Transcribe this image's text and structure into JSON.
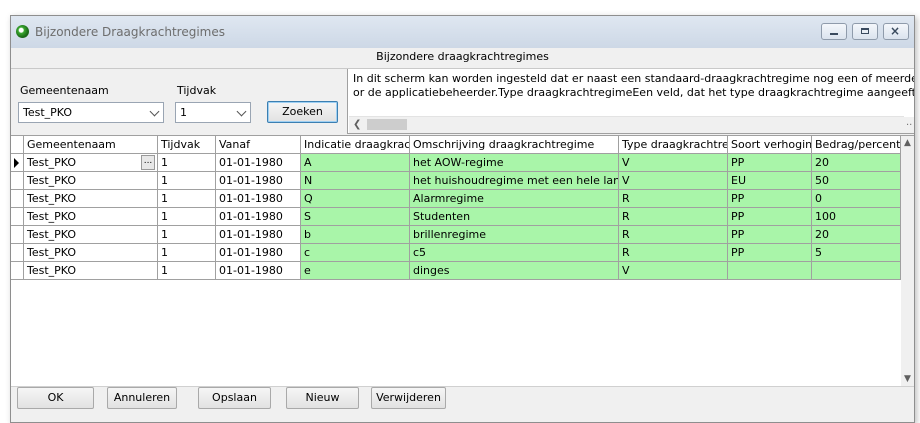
{
  "window": {
    "title": "Bijzondere Draagkrachtregimes",
    "controls": {
      "minimize_icon": "minimize-icon",
      "maximize_icon": "maximize-icon",
      "close_icon": "close-icon"
    }
  },
  "form": {
    "heading": "Bijzondere draagkrachtregimes"
  },
  "filters": {
    "gemeente_label": "Gemeentenaam",
    "gemeente_value": "Test_PKO",
    "tijdvak_label": "Tijdvak",
    "tijdvak_value": "1",
    "search_label": "Zoeken"
  },
  "info": {
    "line1": "In dit scherm kan worden ingesteld dat er naast een standaard-draagkrachtregime nog een of meerdere andere ‘bijzond",
    "line2": "or de applicatiebeheerder.Type draagkrachtregimeEen veld, dat het type draagkrachtregime aangeeft, waarbij de waar"
  },
  "grid": {
    "columns": [
      "Gemeentenaam",
      "Tijdvak",
      "Vanaf",
      "Indicatie draagkrachtre",
      "Omschrijving draagkrachtregime",
      "Type draagkrachtregime",
      "Soort verhoging",
      "Bedrag/percentage"
    ],
    "rows": [
      [
        "Test_PKO",
        "1",
        "01-01-1980",
        "A",
        "het AOW-regime",
        "V",
        "PP",
        "20"
      ],
      [
        "Test_PKO",
        "1",
        "01-01-1980",
        "N",
        "het huishoudregime met een hele lange na",
        "V",
        "EU",
        "50"
      ],
      [
        "Test_PKO",
        "1",
        "01-01-1980",
        "Q",
        "Alarmregime",
        "R",
        "PP",
        "0"
      ],
      [
        "Test_PKO",
        "1",
        "01-01-1980",
        "S",
        "Studenten",
        "R",
        "PP",
        "100"
      ],
      [
        "Test_PKO",
        "1",
        "01-01-1980",
        "b",
        "brillenregime",
        "R",
        "PP",
        "20"
      ],
      [
        "Test_PKO",
        "1",
        "01-01-1980",
        "c",
        "c5",
        "R",
        "PP",
        "5"
      ],
      [
        "Test_PKO",
        "1",
        "01-01-1980",
        "e",
        "dinges",
        "V",
        "",
        ""
      ]
    ],
    "ellipsis_label": "...",
    "highlight_color": "#a9f5a9"
  },
  "footer": {
    "ok": "OK",
    "cancel": "Annuleren",
    "save": "Opslaan",
    "new": "Nieuw",
    "delete": "Verwijderen"
  }
}
